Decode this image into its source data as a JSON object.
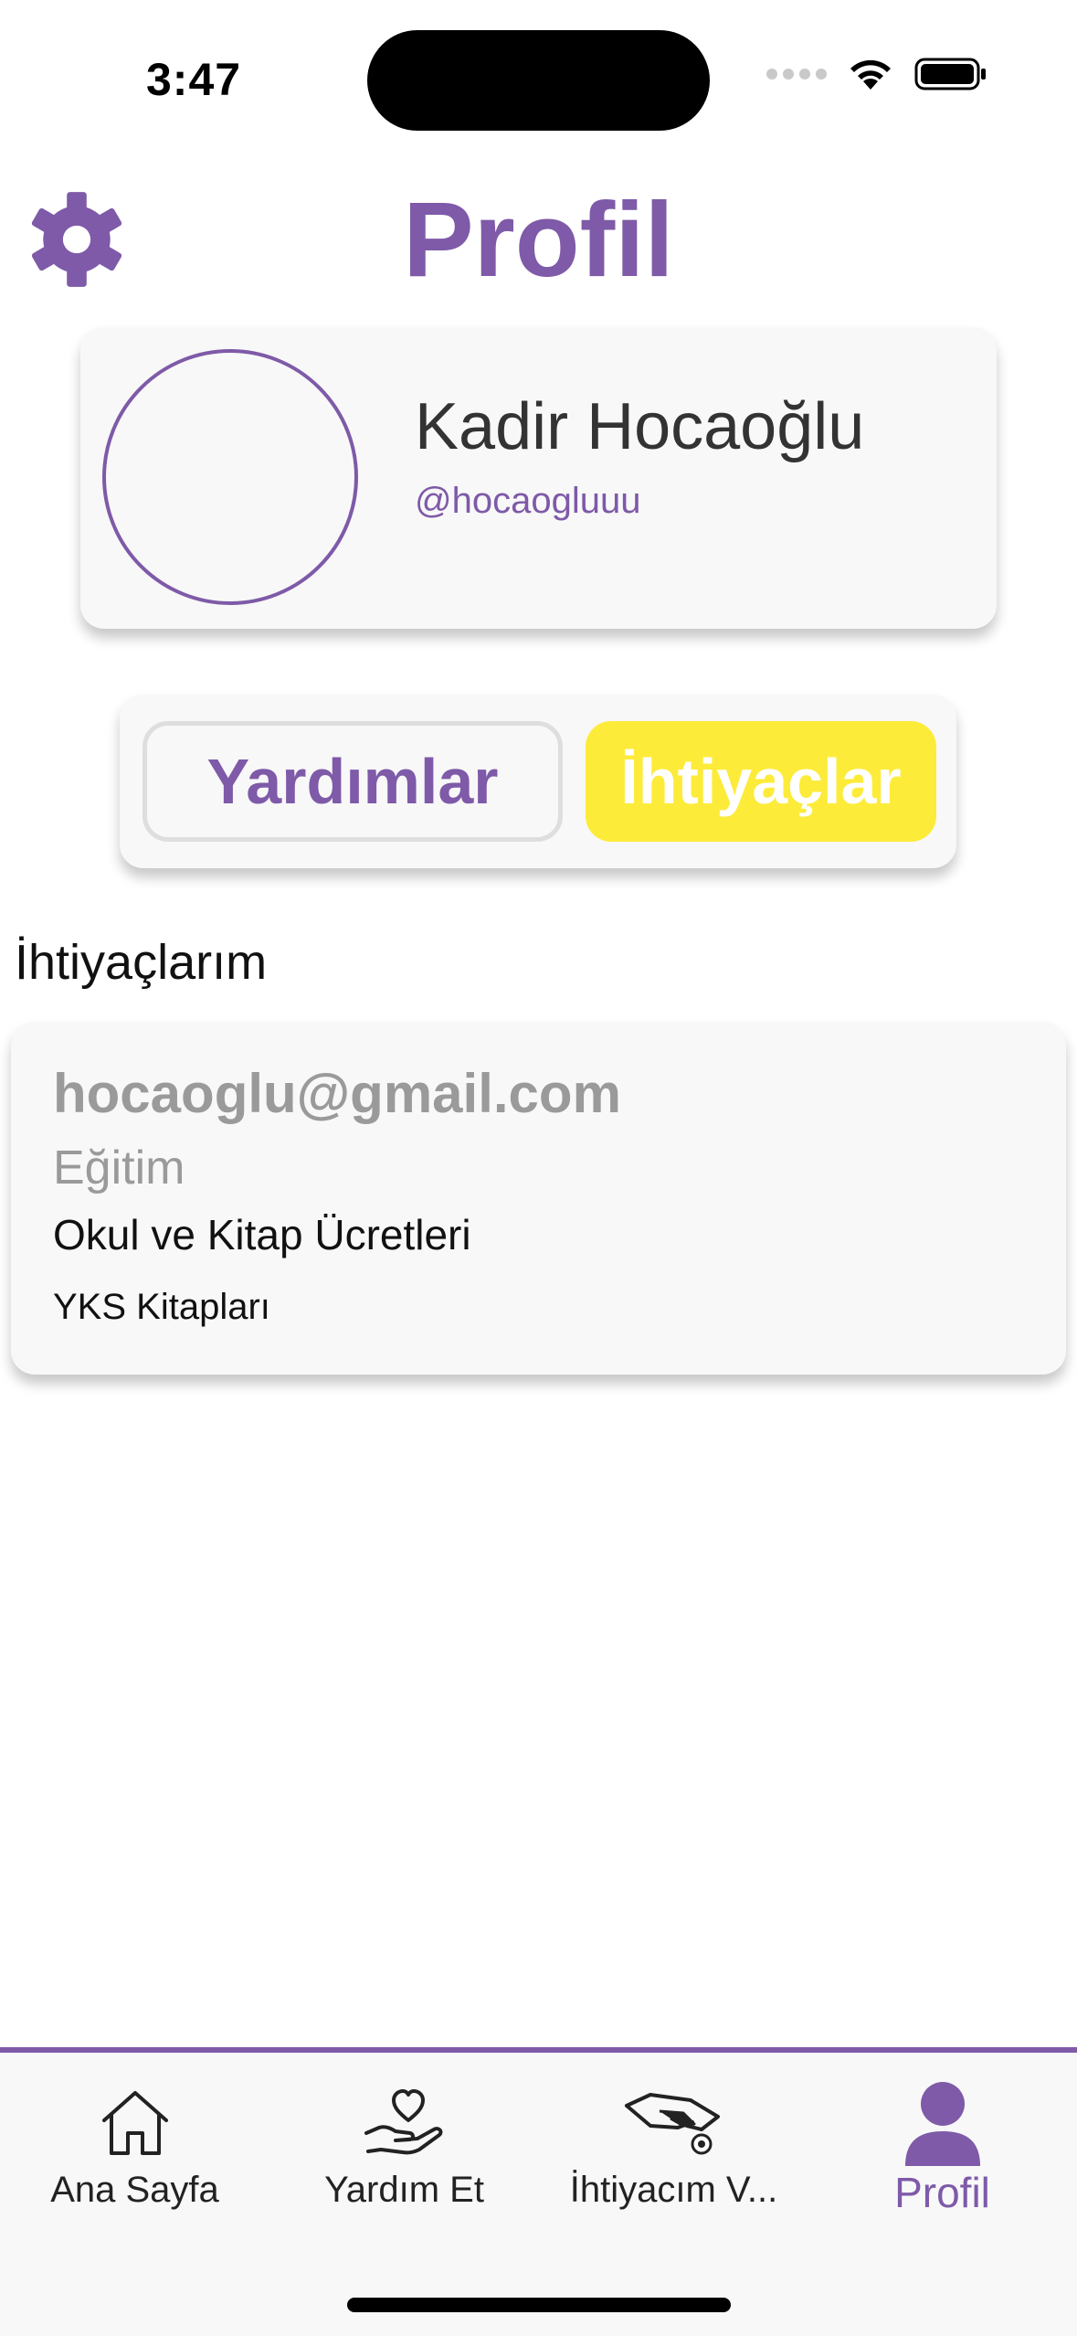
{
  "status_bar": {
    "time": "3:47"
  },
  "header": {
    "title": "Profil",
    "settings_icon": "gear-icon"
  },
  "profile": {
    "name": "Kadir Hocaoğlu",
    "handle": "@hocaogluuu"
  },
  "segment": {
    "items": [
      {
        "label": "Yardımlar",
        "selected": false
      },
      {
        "label": "İhtiyaçlar",
        "selected": true
      }
    ]
  },
  "section": {
    "heading": "İhtiyaçlarım"
  },
  "needs": [
    {
      "email": "hocaoglu@gmail.com",
      "category": "Eğitim",
      "title": "Okul ve Kitap Ücretleri",
      "description": "YKS Kitapları"
    }
  ],
  "tab_bar": {
    "items": [
      {
        "label": "Ana Sayfa",
        "icon": "home-icon",
        "active": false
      },
      {
        "label": "Yardım Et",
        "icon": "heart-hand-icon",
        "active": false
      },
      {
        "label": "İhtiyacım V...",
        "icon": "hand-coin-icon",
        "active": false
      },
      {
        "label": "Profil",
        "icon": "person-icon",
        "active": true
      }
    ]
  },
  "colors": {
    "accent": "#7e5aa8",
    "highlight": "#fdeb3a",
    "card": "#f8f8f8"
  }
}
